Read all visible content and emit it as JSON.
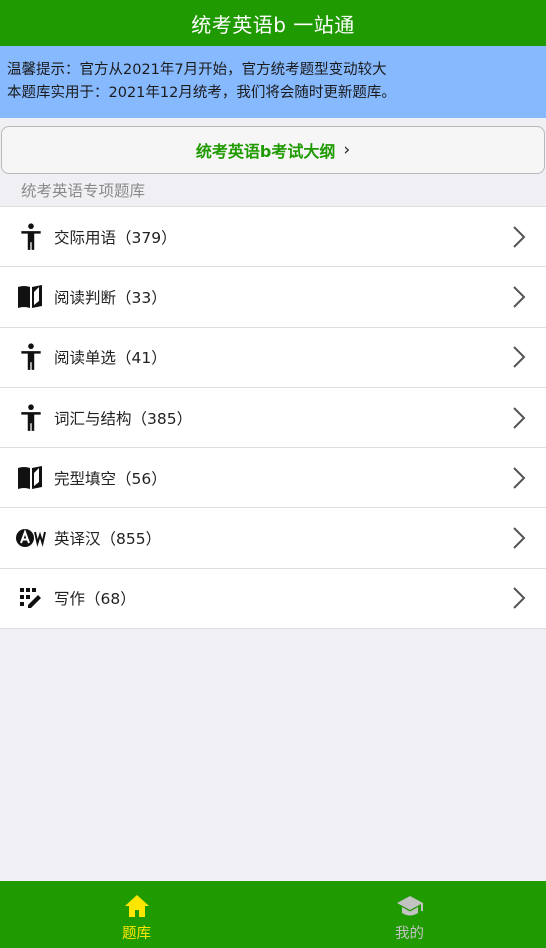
{
  "header": {
    "title": "统考英语b 一站通"
  },
  "notice": {
    "line1": "温馨提示：官方从2021年7月开始，官方统考题型变动较大",
    "line2": "本题库实用于：2021年12月统考，我们将会随时更新题库。"
  },
  "outline_button": {
    "label": "统考英语b考试大纲",
    "chevron": "›"
  },
  "section": {
    "label": "统考英语专项题库"
  },
  "items": [
    {
      "label": "交际用语（379）",
      "icon": "accessibility-icon"
    },
    {
      "label": "阅读判断（33）",
      "icon": "book-icon"
    },
    {
      "label": "阅读单选（41）",
      "icon": "accessibility-icon"
    },
    {
      "label": "词汇与结构（385）",
      "icon": "accessibility-icon"
    },
    {
      "label": "完型填空（56）",
      "icon": "book-icon"
    },
    {
      "label": "英译汉（855）",
      "icon": "translate-icon"
    },
    {
      "label": "写作（68）",
      "icon": "edit-grid-icon"
    }
  ],
  "tabbar": {
    "tabs": [
      {
        "label": "题库",
        "icon": "home-icon",
        "active": true
      },
      {
        "label": "我的",
        "icon": "graduation-cap-icon",
        "active": false
      }
    ]
  },
  "colors": {
    "brand_green": "#1f9a00",
    "notice_blue": "#87b9ff",
    "active_tab": "#ffe600",
    "inactive_tab": "#c3c3c3"
  }
}
